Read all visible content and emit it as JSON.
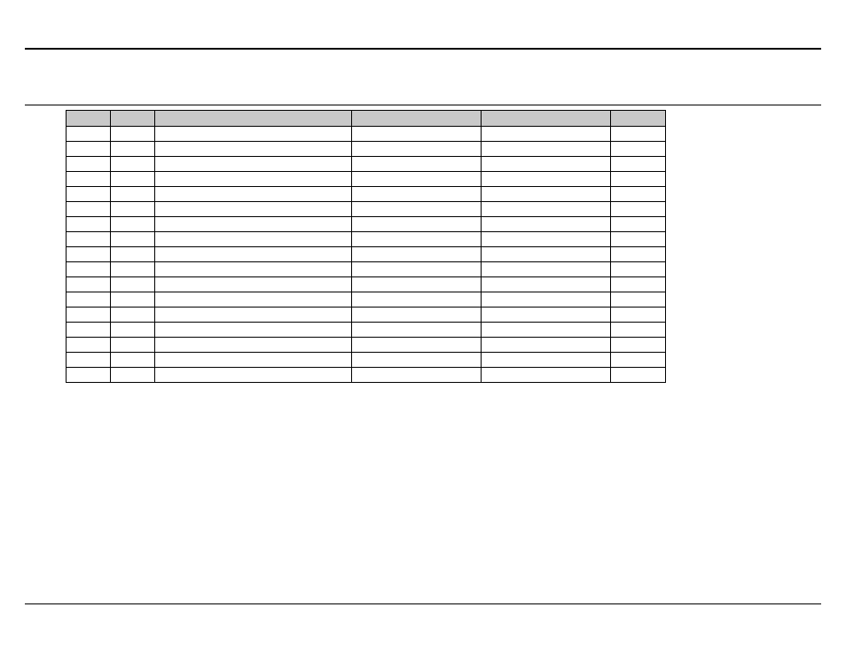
{
  "table": {
    "headers": [
      "",
      "",
      "",
      "",
      "",
      ""
    ],
    "rows": [
      [
        "",
        "",
        "",
        "",
        "",
        ""
      ],
      [
        "",
        "",
        "",
        "",
        "",
        ""
      ],
      [
        "",
        "",
        "",
        "",
        "",
        ""
      ],
      [
        "",
        "",
        "",
        "",
        "",
        ""
      ],
      [
        "",
        "",
        "",
        "",
        "",
        ""
      ],
      [
        "",
        "",
        "",
        "",
        "",
        ""
      ],
      [
        "",
        "",
        "",
        "",
        "",
        ""
      ],
      [
        "",
        "",
        "",
        "",
        "",
        ""
      ],
      [
        "",
        "",
        "",
        "",
        "",
        ""
      ],
      [
        "",
        "",
        "",
        "",
        "",
        ""
      ],
      [
        "",
        "",
        "",
        "",
        "",
        ""
      ],
      [
        "",
        "",
        "",
        "",
        "",
        ""
      ],
      [
        "",
        "",
        "",
        "",
        "",
        ""
      ],
      [
        "",
        "",
        "",
        "",
        "",
        ""
      ],
      [
        "",
        "",
        "",
        "",
        "",
        ""
      ],
      [
        "",
        "",
        "",
        "",
        "",
        ""
      ],
      [
        "",
        "",
        "",
        "",
        "",
        ""
      ]
    ]
  }
}
